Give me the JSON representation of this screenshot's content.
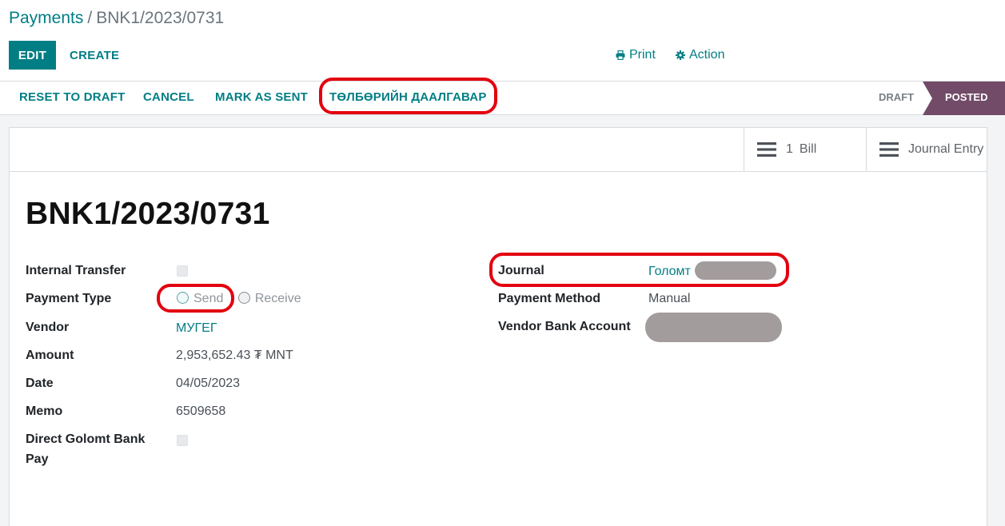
{
  "breadcrumb": {
    "root": "Payments",
    "separator": "/",
    "current": "BNK1/2023/0731"
  },
  "toolbar": {
    "edit_label": "EDIT",
    "create_label": "CREATE",
    "print_label": "Print",
    "action_label": "Action"
  },
  "statusbar": {
    "buttons": [
      "RESET TO DRAFT",
      "CANCEL",
      "MARK AS SENT",
      "ТӨЛБӨРИЙН ДААЛГАВАР"
    ],
    "stages": [
      {
        "label": "DRAFT",
        "active": false
      },
      {
        "label": "POSTED",
        "active": true
      }
    ]
  },
  "smart_buttons": {
    "bill": {
      "count": "1",
      "label": "Bill"
    },
    "journal_entry": {
      "label": "Journal Entry"
    }
  },
  "record": {
    "name": "BNK1/2023/0731",
    "internal_transfer": {
      "label": "Internal Transfer",
      "checked": false
    },
    "payment_type": {
      "label": "Payment Type",
      "options": [
        "Send",
        "Receive"
      ],
      "selected": "Send"
    },
    "vendor": {
      "label": "Vendor",
      "value": "МУГЕГ"
    },
    "amount": {
      "label": "Amount",
      "value": "2,953,652.43 ₮ MNT"
    },
    "date": {
      "label": "Date",
      "value": "04/05/2023"
    },
    "memo": {
      "label": "Memo",
      "value": "6509658"
    },
    "direct_golomt": {
      "label_line1": "Direct Golomt Bank",
      "label_line2": "Pay",
      "checked": false
    },
    "journal": {
      "label": "Journal",
      "value": "Голомт"
    },
    "payment_method": {
      "label": "Payment Method",
      "value": "Manual"
    },
    "vendor_bank_account": {
      "label": "Vendor Bank Account"
    }
  },
  "colors": {
    "primary": "#017e84",
    "stage_active": "#714b67",
    "highlight": "#e3000f",
    "redaction": "#a39c9c"
  },
  "icons": {
    "print": "print-icon",
    "action": "gear-icon",
    "smart_button": "list-icon"
  }
}
